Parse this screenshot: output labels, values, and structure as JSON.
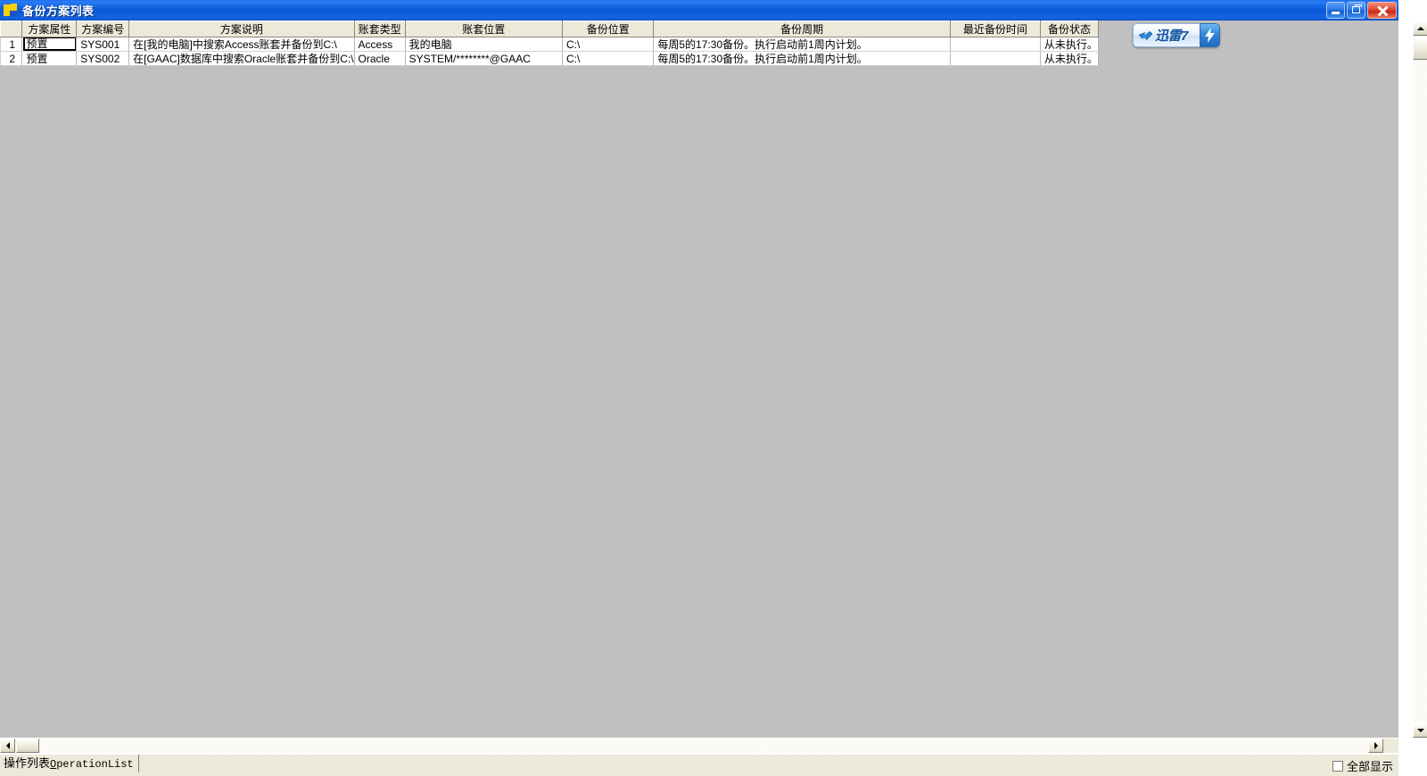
{
  "window": {
    "title": "备份方案列表",
    "icon": "app-icon",
    "buttons": {
      "minimize": "最小化",
      "restore": "还原",
      "close": "关闭"
    }
  },
  "grid": {
    "columns": [
      {
        "key": "rownum",
        "label": ""
      },
      {
        "key": "attr",
        "label": "方案属性"
      },
      {
        "key": "code",
        "label": "方案编号"
      },
      {
        "key": "desc",
        "label": "方案说明"
      },
      {
        "key": "type",
        "label": "账套类型"
      },
      {
        "key": "loc",
        "label": "账套位置"
      },
      {
        "key": "bakloc",
        "label": "备份位置"
      },
      {
        "key": "cycle",
        "label": "备份周期"
      },
      {
        "key": "lasttime",
        "label": "最近备份时间"
      },
      {
        "key": "status",
        "label": "备份状态"
      }
    ],
    "rows": [
      {
        "rownum": "1",
        "attr": "预置",
        "code": "SYS001",
        "desc": "在[我的电脑]中搜索Access账套并备份到C:\\",
        "type": "Access",
        "loc": "我的电脑",
        "bakloc": "C:\\",
        "cycle": "每周5的17:30备份。执行启动前1周内计划。",
        "lasttime": "",
        "status": "从未执行。",
        "selected_cell": "attr"
      },
      {
        "rownum": "2",
        "attr": "预置",
        "code": "SYS002",
        "desc": "在[GAAC]数据库中搜索Oracle账套并备份到C:\\",
        "type": "Oracle",
        "loc": "SYSTEM/********@GAAC",
        "bakloc": "C:\\",
        "cycle": "每周5的17:30备份。执行启动前1周内计划。",
        "lasttime": "",
        "status": "从未执行。",
        "selected_cell": ""
      }
    ]
  },
  "thunder_widget": {
    "label": "迅雷7",
    "bird_icon": "thunder-bird-icon",
    "bolt_icon": "lightning-bolt-icon"
  },
  "statusbar": {
    "tab_label_cn": "操作列表",
    "tab_label_en": "OperationList",
    "tab_mnemonic": "O",
    "tab_rest": "perationList",
    "show_all_label": "全部显示",
    "show_all_checked": false
  },
  "scrollbars": {
    "vertical": {
      "up": "▲",
      "down": "▼"
    },
    "horizontal": {
      "left": "◀",
      "right": "▶"
    }
  },
  "colors": {
    "titlebar_blue": "#0a58d6",
    "client_gray": "#c0c0c0",
    "header_beige": "#ece9d8",
    "close_red": "#c62a14"
  }
}
